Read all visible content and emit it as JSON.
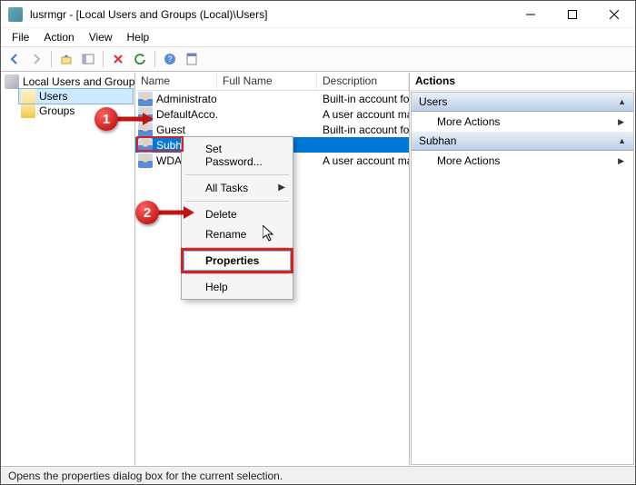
{
  "window": {
    "title": "lusrmgr - [Local Users and Groups (Local)\\Users]"
  },
  "menu": {
    "file": "File",
    "action": "Action",
    "view": "View",
    "help": "Help"
  },
  "tree": {
    "root": "Local Users and Groups (Local)",
    "users": "Users",
    "groups": "Groups"
  },
  "columns": {
    "name": "Name",
    "fullname": "Full Name",
    "description": "Description"
  },
  "rows": [
    {
      "name": "Administrator",
      "fullname": "",
      "description": "Built-in account for adm"
    },
    {
      "name": "DefaultAcco...",
      "fullname": "",
      "description": "A user account manage"
    },
    {
      "name": "Guest",
      "fullname": "",
      "description": "Built-in account for gue"
    },
    {
      "name": "Subhan",
      "fullname": "",
      "description": ""
    },
    {
      "name": "WDAG...",
      "fullname": "",
      "description": "A user account manage"
    }
  ],
  "contextmenu": {
    "setpassword": "Set Password...",
    "alltasks": "All Tasks",
    "delete": "Delete",
    "rename": "Rename",
    "properties": "Properties",
    "help": "Help"
  },
  "actions": {
    "header": "Actions",
    "section1": "Users",
    "section2": "Subhan",
    "more": "More Actions"
  },
  "statusbar": {
    "text": "Opens the properties dialog box for the current selection."
  },
  "annotations": {
    "m1": "1",
    "m2": "2"
  }
}
